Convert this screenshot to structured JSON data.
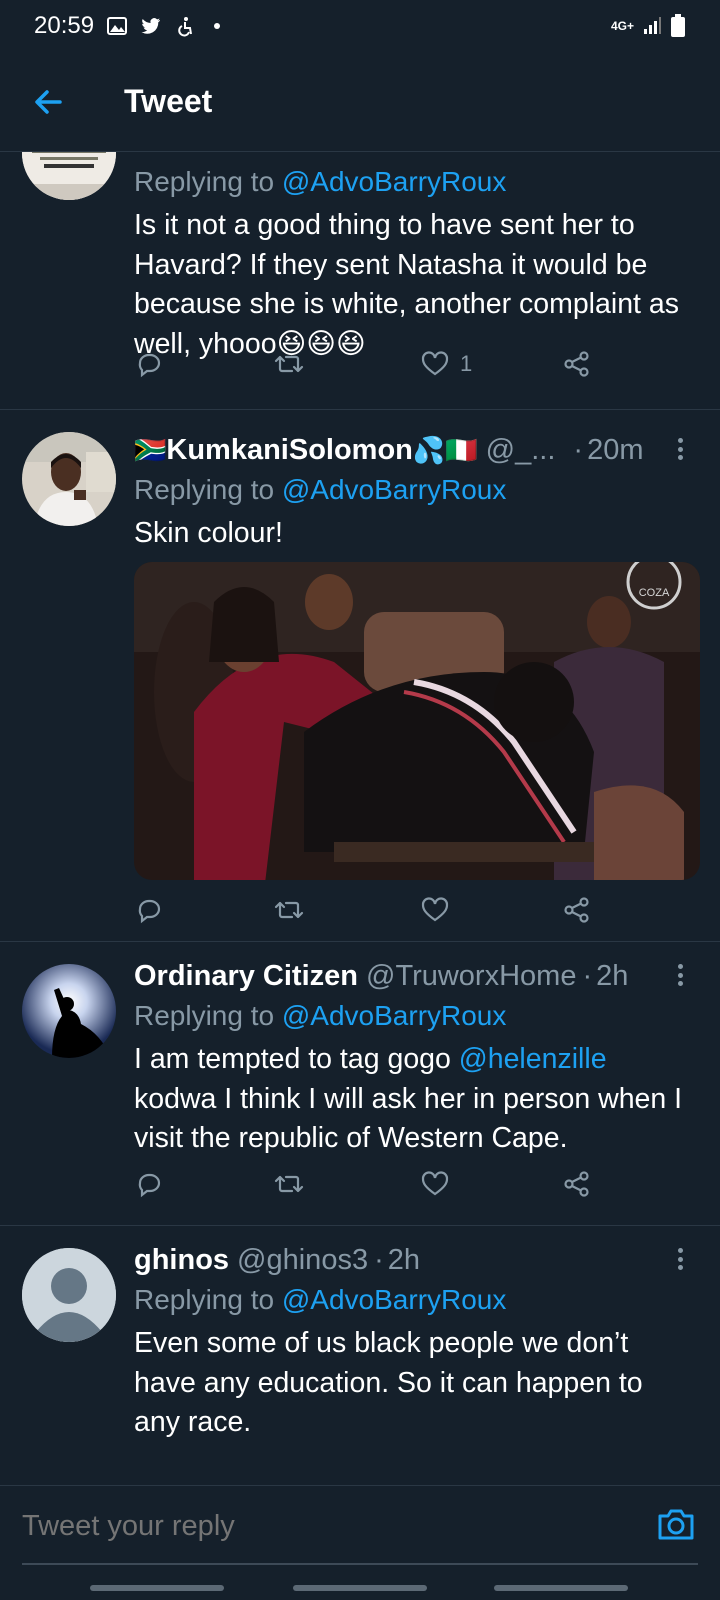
{
  "status": {
    "time": "20:59",
    "network": "4G+"
  },
  "header": {
    "title": "Tweet"
  },
  "tweets": [
    {
      "replying_prefix": "Replying to",
      "replying_to": "@AdvoBarryRoux",
      "text": "Is it not a good thing to have sent her to Havard? If they sent Natasha it would be because she is white, another complaint as well, yhooo😆😆😆",
      "like_count": "1"
    },
    {
      "name": "KumkaniSolomon",
      "name_prefix_emoji": "🇿🇦",
      "name_suffix_emoji": "💦🇮🇹",
      "handle": "@_...",
      "separator": "·",
      "time": "20m",
      "replying_prefix": "Replying to",
      "replying_to": "@AdvoBarryRoux",
      "text": "Skin colour!",
      "image_watermark": "COZA"
    },
    {
      "name": "Ordinary Citizen",
      "handle": "@TruworxHome",
      "separator": "·",
      "time": "2h",
      "replying_prefix": "Replying to",
      "replying_to": "@AdvoBarryRoux",
      "text_before": "I am tempted to tag gogo ",
      "text_mention": "@helenzille",
      "text_after": " kodwa I think I will ask her in person when I visit the republic of Western Cape."
    },
    {
      "name": "ghinos",
      "handle": "@ghinos3",
      "separator": "·",
      "time": "2h",
      "replying_prefix": "Replying to",
      "replying_to": "@AdvoBarryRoux",
      "text": "Even some of us black people we don’t have any education. So it can happen to any race."
    }
  ],
  "reply": {
    "placeholder": "Tweet your reply"
  },
  "colors": {
    "background": "#15202b",
    "accent": "#1da1f2",
    "secondary_text": "#8899a6"
  }
}
